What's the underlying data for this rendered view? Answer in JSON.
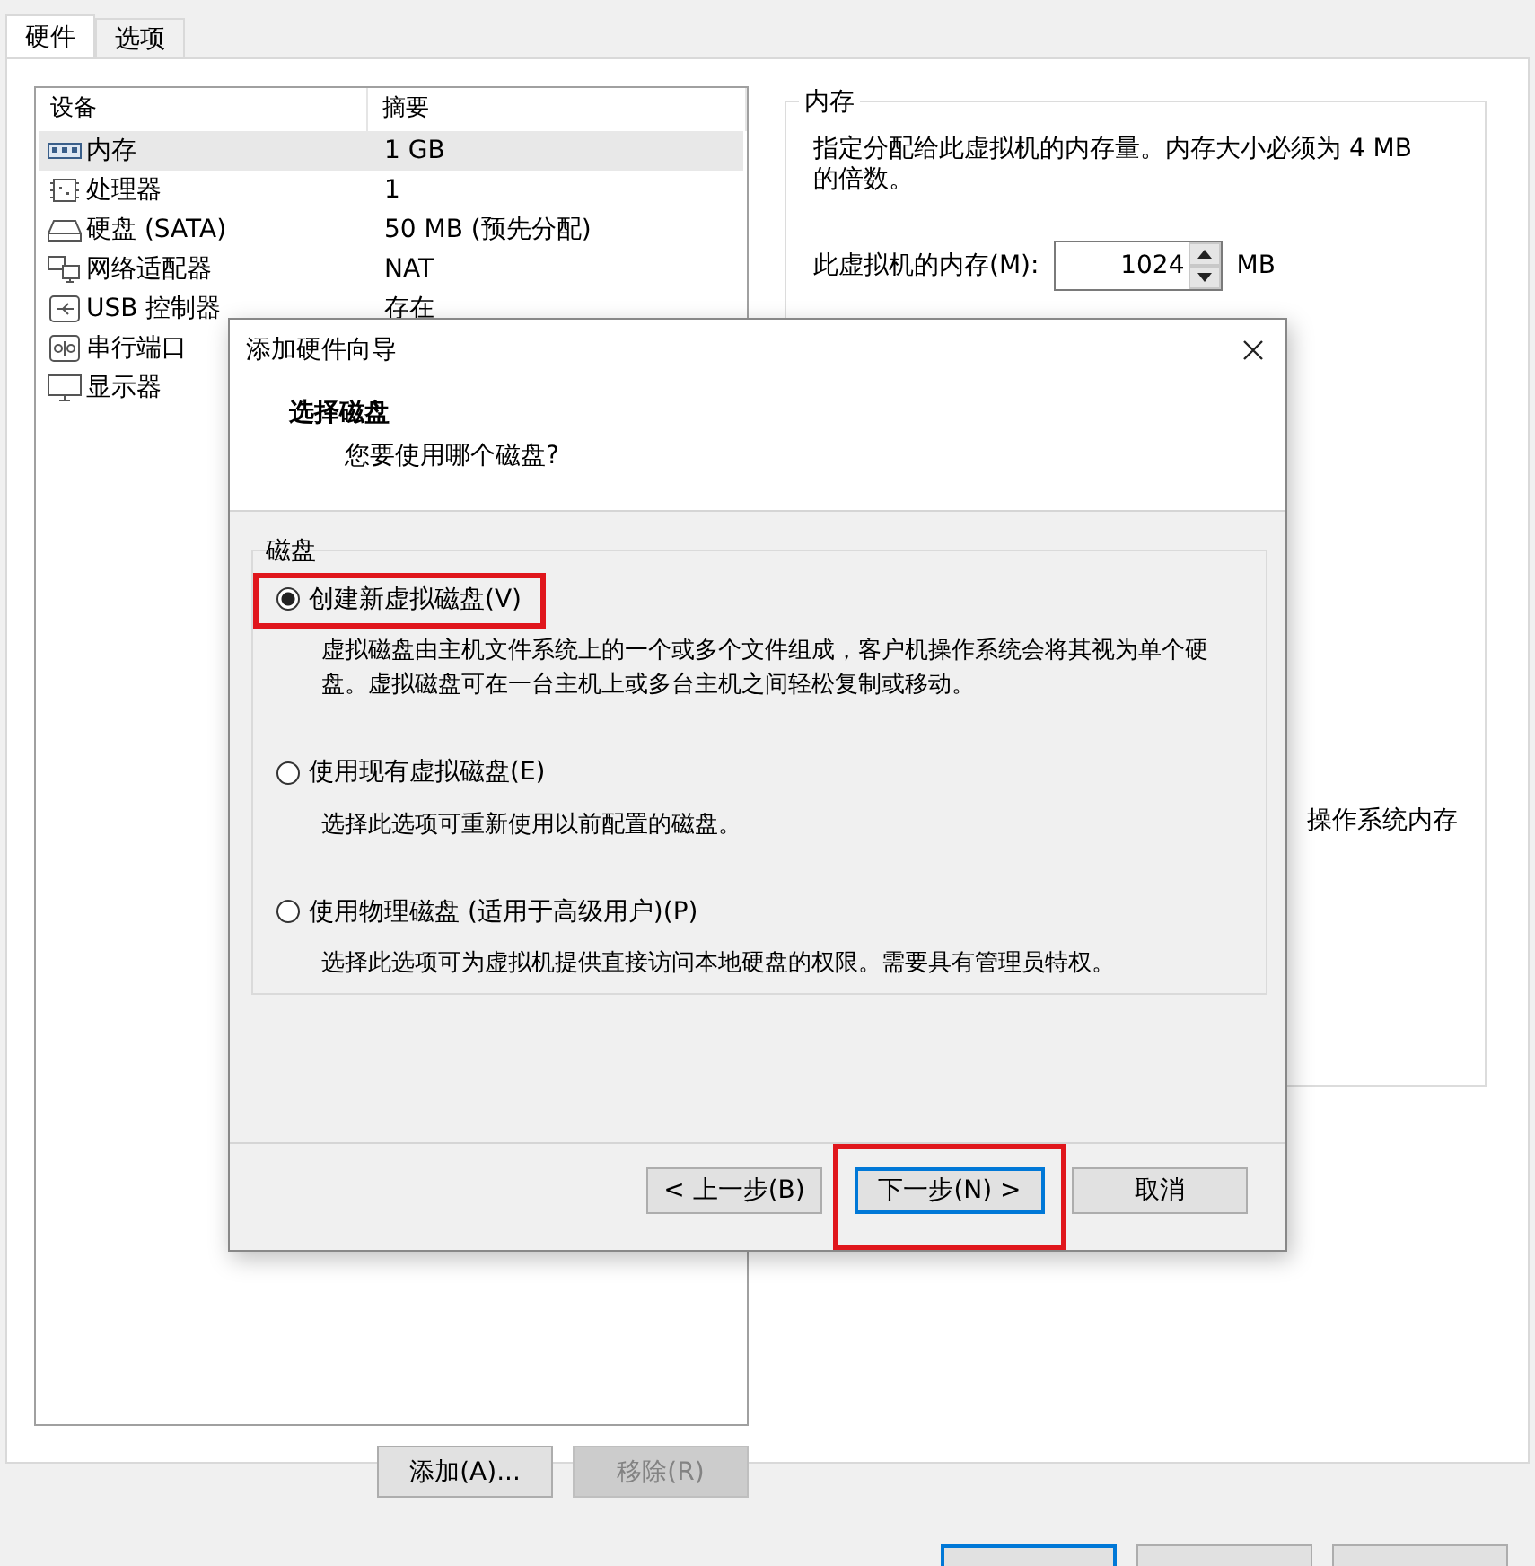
{
  "tabs": [
    {
      "label": "硬件",
      "selected": true
    },
    {
      "label": "选项",
      "selected": false
    }
  ],
  "devices": {
    "columns": [
      "设备",
      "摘要"
    ],
    "rows": [
      {
        "kind": "memory",
        "name": "内存",
        "summary": "1 GB",
        "selected": true
      },
      {
        "kind": "cpu",
        "name": "处理器",
        "summary": "1",
        "selected": false
      },
      {
        "kind": "disk",
        "name": "硬盘 (SATA)",
        "summary": "50 MB (预先分配)",
        "selected": false
      },
      {
        "kind": "network",
        "name": "网络适配器",
        "summary": "NAT",
        "selected": false
      },
      {
        "kind": "usb",
        "name": "USB 控制器",
        "summary": "存在",
        "selected": false
      },
      {
        "kind": "serial",
        "name": "串行端口",
        "selected": false
      },
      {
        "kind": "display",
        "name": "显示器",
        "selected": false
      }
    ]
  },
  "device_buttons": [
    {
      "label": "添加(A)...",
      "disabled": false
    },
    {
      "label": "移除(R)",
      "disabled": true
    }
  ],
  "memory": {
    "title": "内存",
    "description": "指定分配给此虚拟机的内存量。内存大小必须为 4 MB 的倍数。",
    "field_label": "此虚拟机的内存(M):",
    "value": "1024",
    "unit": "MB",
    "partial_text": "操作系统内存"
  },
  "dialog": {
    "title": "添加硬件向导",
    "heading": "选择磁盘",
    "subheading": "您要使用哪个磁盘?",
    "group_title": "磁盘",
    "options": [
      {
        "label": "创建新虚拟磁盘(V)",
        "description": "虚拟磁盘由主机文件系统上的一个或多个文件组成，客户机操作系统会将其视为单个硬盘。虚拟磁盘可在一台主机上或多台主机之间轻松复制或移动。",
        "selected": true,
        "highlighted": true
      },
      {
        "label": "使用现有虚拟磁盘(E)",
        "description": "选择此选项可重新使用以前配置的磁盘。",
        "selected": false,
        "highlighted": false
      },
      {
        "label": "使用物理磁盘 (适用于高级用户)(P)",
        "description": "选择此选项可为虚拟机提供直接访问本地硬盘的权限。需要具有管理员特权。",
        "selected": false,
        "highlighted": false
      }
    ],
    "buttons": [
      {
        "label": "< 上一步(B)",
        "default": false,
        "highlighted": false
      },
      {
        "label": "下一步(N) >",
        "default": true,
        "highlighted": true
      },
      {
        "label": "取消",
        "default": false,
        "highlighted": false
      }
    ]
  },
  "footer_buttons": [
    {
      "default": true
    },
    {
      "default": false
    },
    {
      "default": false
    }
  ]
}
